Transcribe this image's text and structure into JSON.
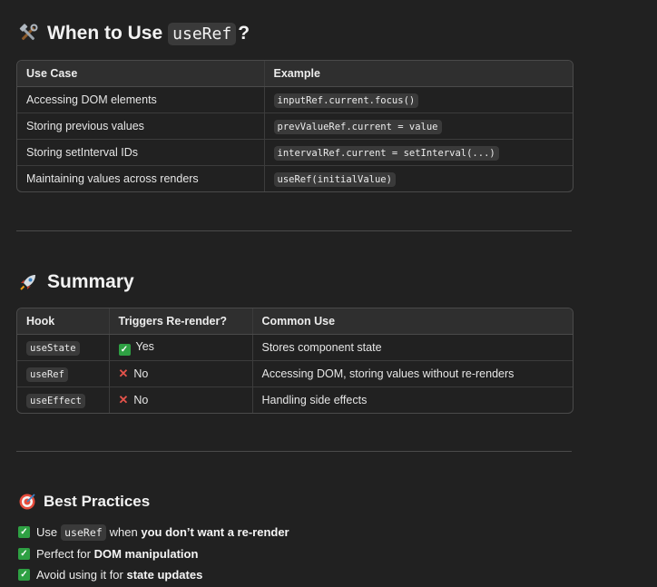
{
  "section1": {
    "title_prefix": "When to Use",
    "title_code": "useRef",
    "title_suffix": "?",
    "icon": "hammer-wrench-icon",
    "headers": [
      "Use Case",
      "Example"
    ],
    "rows": [
      {
        "use_case": "Accessing DOM elements",
        "example": "inputRef.current.focus()"
      },
      {
        "use_case": "Storing previous values",
        "example": "prevValueRef.current = value"
      },
      {
        "use_case": "Storing setInterval IDs",
        "example": "intervalRef.current = setInterval(...)"
      },
      {
        "use_case": "Maintaining values across renders",
        "example": "useRef(initialValue)"
      }
    ]
  },
  "section2": {
    "title": "Summary",
    "icon": "rocket-icon",
    "headers": [
      "Hook",
      "Triggers Re-render?",
      "Common Use"
    ],
    "rows": [
      {
        "hook": "useState",
        "triggers": "Yes",
        "triggers_icon": "check-icon",
        "use": "Stores component state"
      },
      {
        "hook": "useRef",
        "triggers": "No",
        "triggers_icon": "cross-icon",
        "use": "Accessing DOM, storing values without re-renders"
      },
      {
        "hook": "useEffect",
        "triggers": "No",
        "triggers_icon": "cross-icon",
        "use": "Handling side effects"
      }
    ]
  },
  "section3": {
    "title": "Best Practices",
    "icon": "target-icon",
    "items": [
      {
        "pre": "Use",
        "code": "useRef",
        "mid": "when",
        "bold": "you don’t want a re-render"
      },
      {
        "pre": "Perfect for",
        "bold": "DOM manipulation"
      },
      {
        "pre": "Avoid using it for",
        "bold": "state updates"
      }
    ]
  },
  "colors": {
    "background": "#212121",
    "check_green": "#2ea043",
    "cross_red": "#e5534b"
  }
}
